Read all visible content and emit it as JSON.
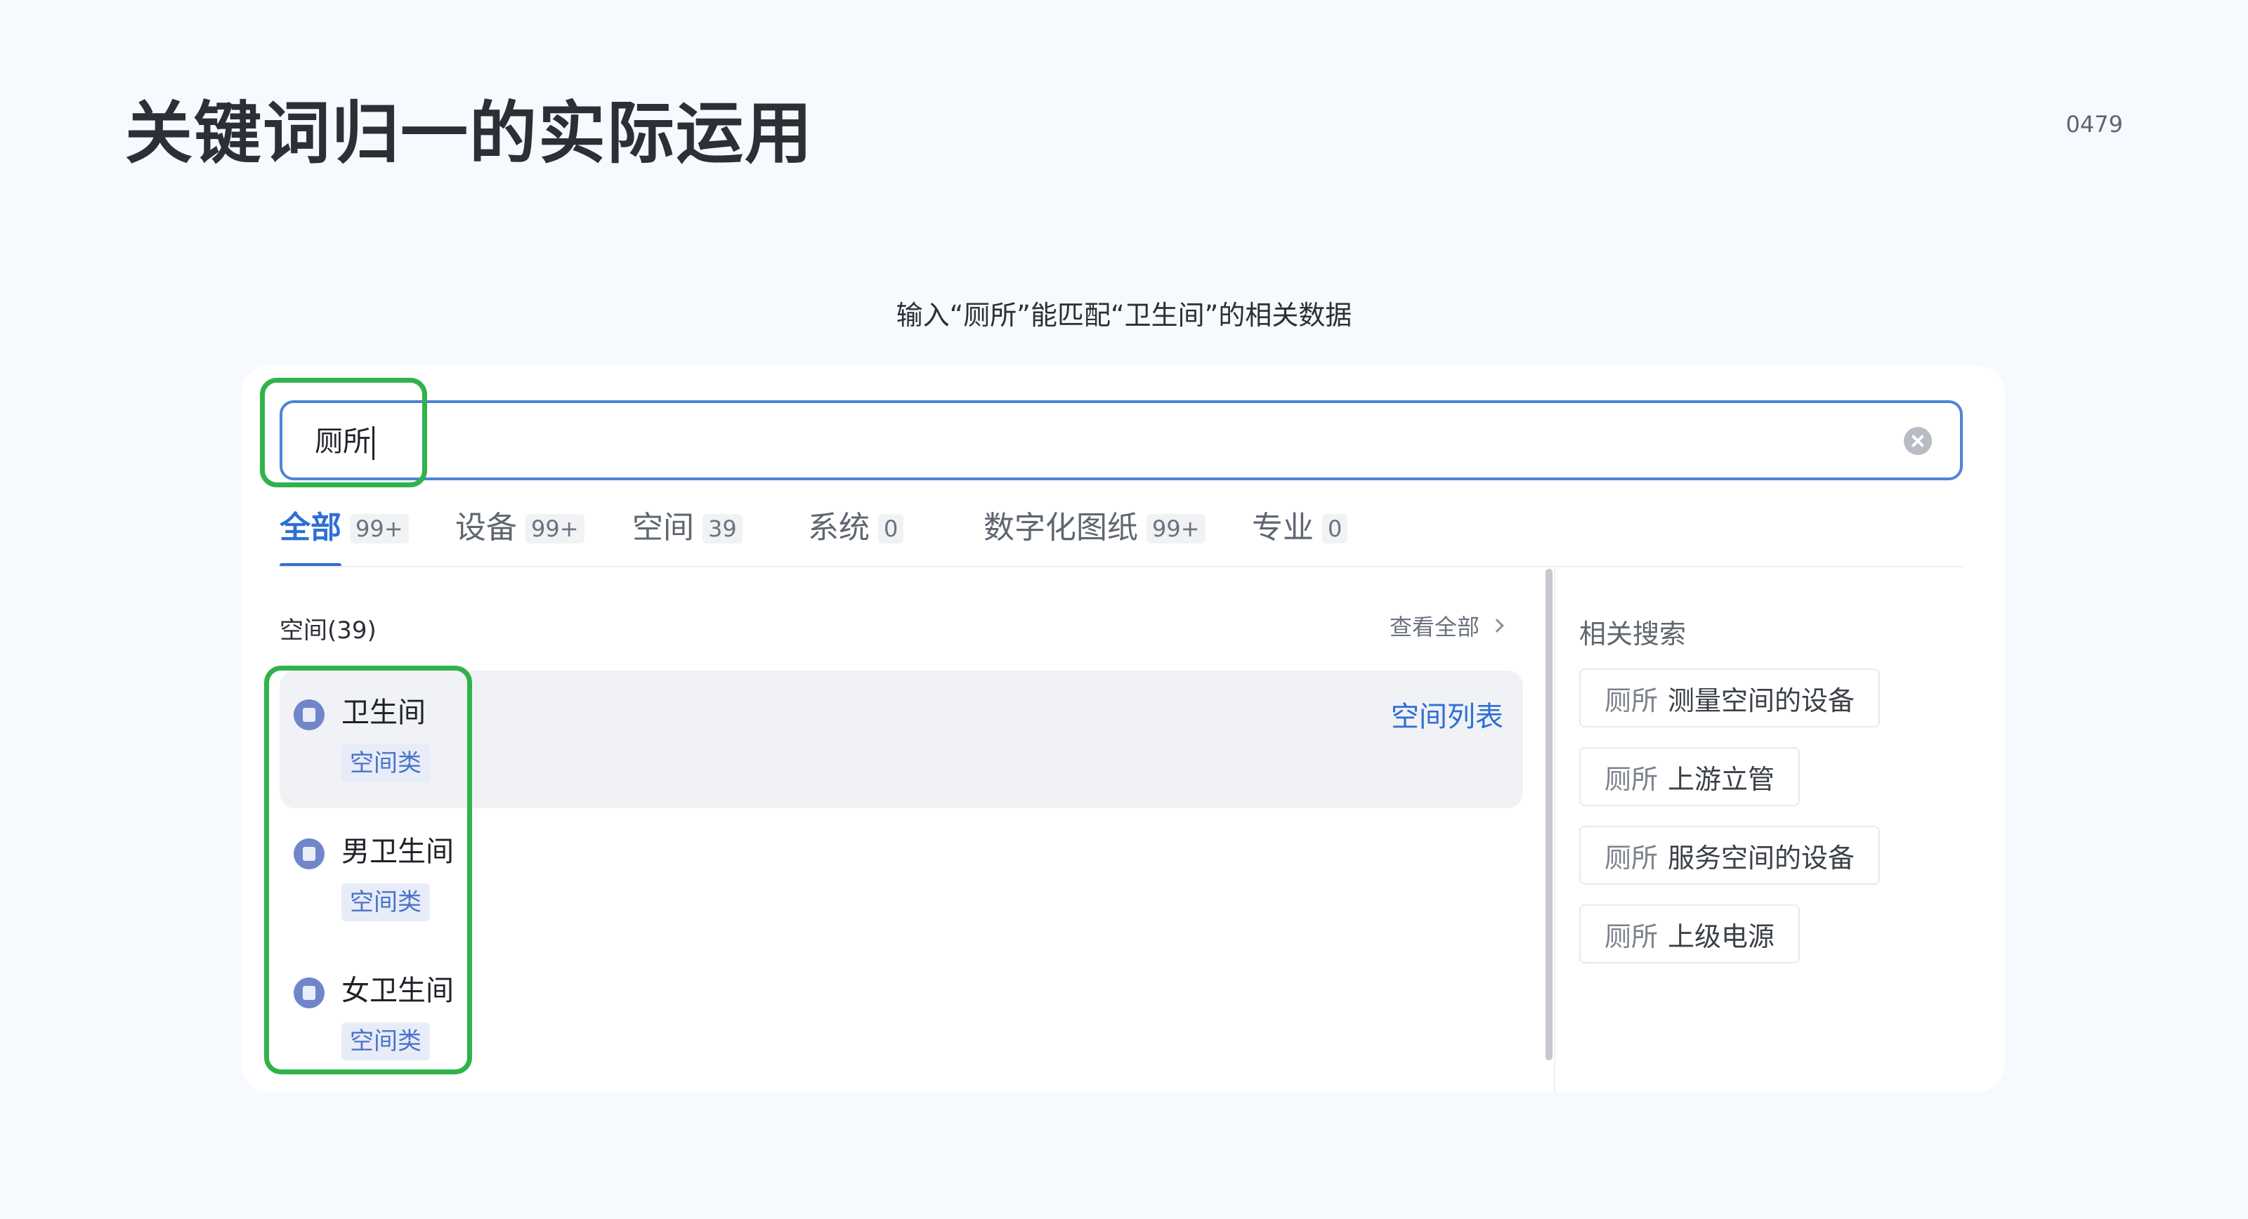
{
  "page": {
    "title": "关键词归一的实际运用",
    "number": "0479",
    "caption": "输入“厕所”能匹配“卫生间”的相关数据"
  },
  "search": {
    "value": "厕所"
  },
  "tabs": [
    {
      "label": "全部",
      "count": "99+",
      "active": true
    },
    {
      "label": "设备",
      "count": "99+",
      "active": false
    },
    {
      "label": "空间",
      "count": "39",
      "active": false
    },
    {
      "label": "系统",
      "count": "0",
      "active": false
    },
    {
      "label": "数字化图纸",
      "count": "99+",
      "active": false
    },
    {
      "label": "专业",
      "count": "0",
      "active": false
    }
  ],
  "results": {
    "section_title": "空间(39)",
    "view_all": "查看全部",
    "list_link": "空间列表",
    "items": [
      {
        "name": "卫生间",
        "tag": "空间类"
      },
      {
        "name": "男卫生间",
        "tag": "空间类"
      },
      {
        "name": "女卫生间",
        "tag": "空间类"
      }
    ]
  },
  "related": {
    "title": "相关搜索",
    "items": [
      {
        "keyword": "厕所",
        "text": "测量空间的设备"
      },
      {
        "keyword": "厕所",
        "text": "上游立管"
      },
      {
        "keyword": "厕所",
        "text": "服务空间的设备"
      },
      {
        "keyword": "厕所",
        "text": "上级电源"
      }
    ]
  },
  "colors": {
    "accent": "#2f6fd4",
    "highlight": "#2fb34a",
    "background": "#f6f9fd"
  }
}
